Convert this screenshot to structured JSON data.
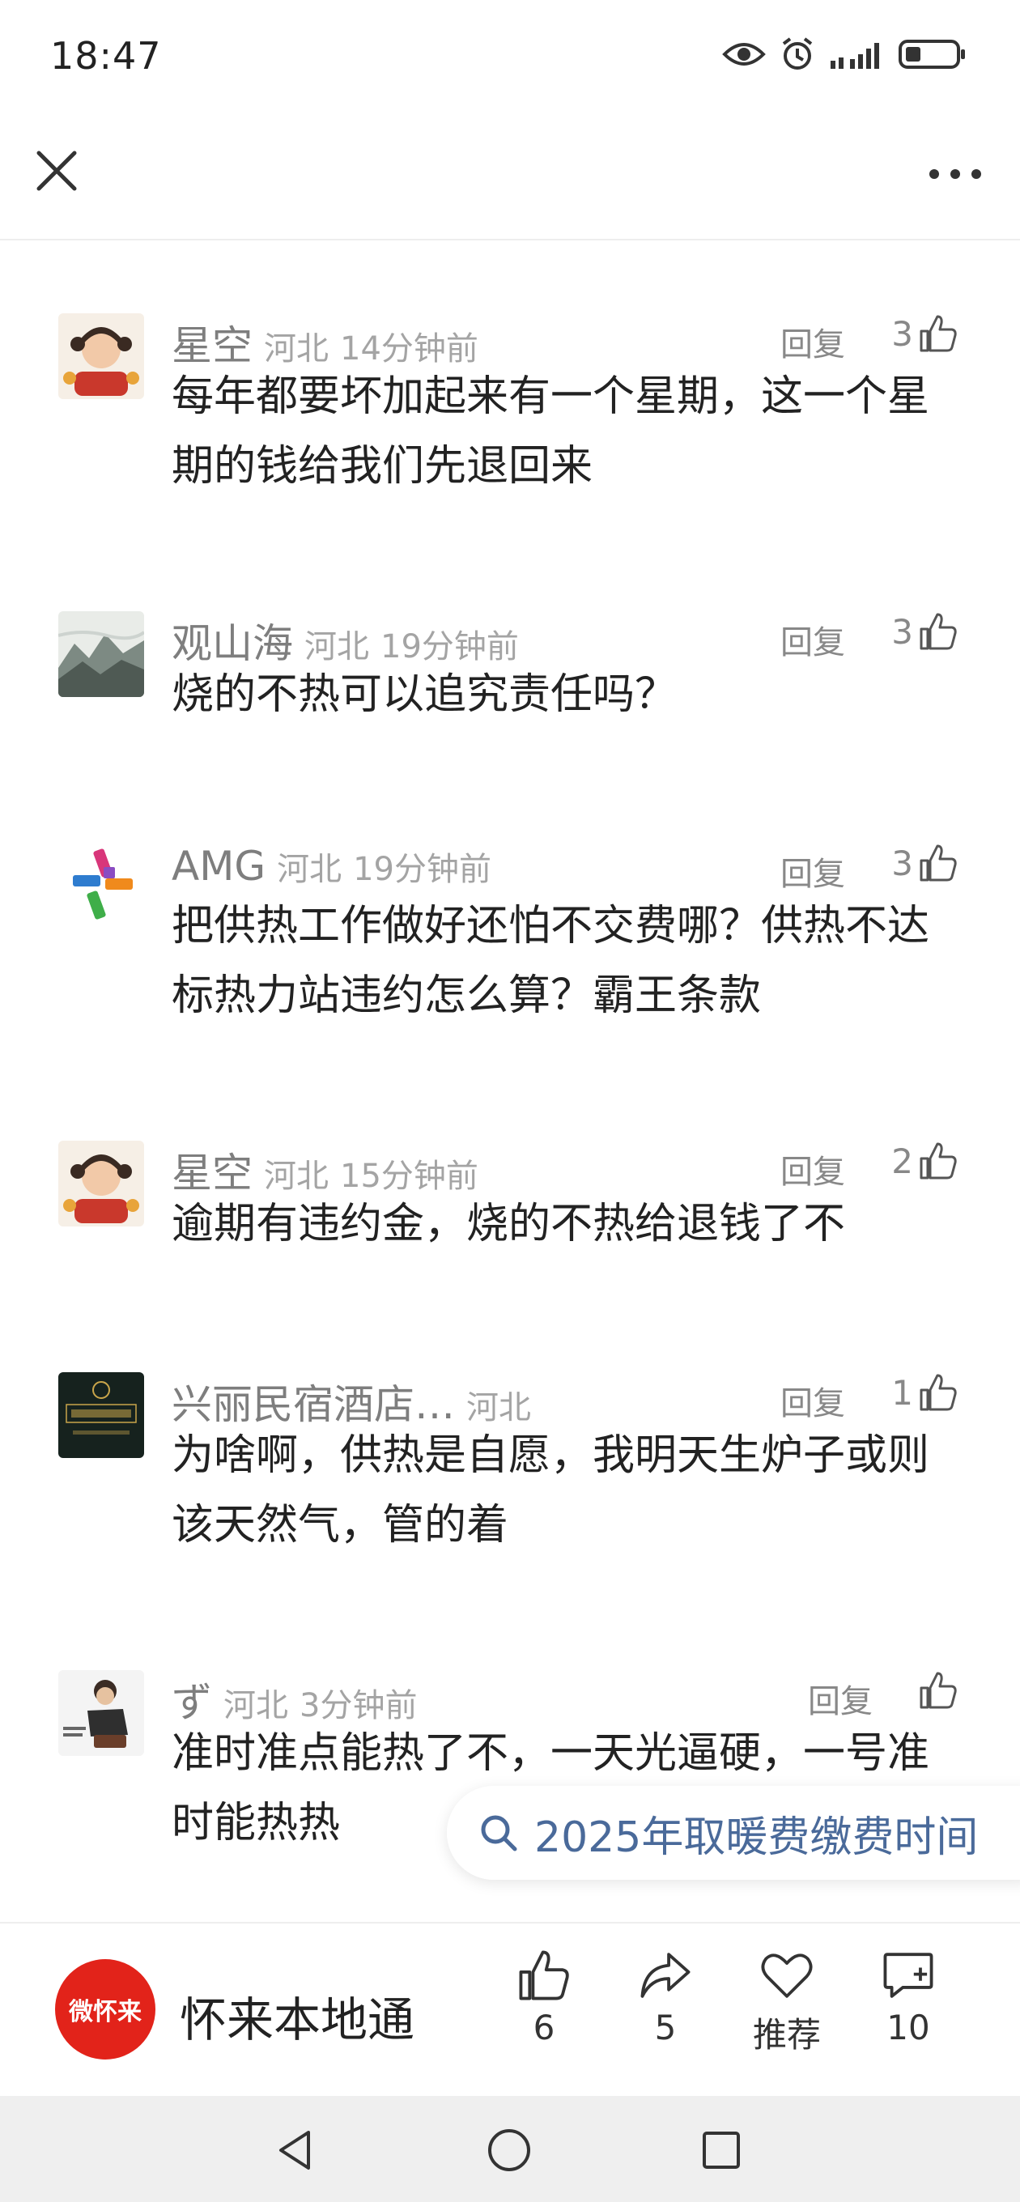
{
  "status_bar": {
    "time": "18:47"
  },
  "comments": [
    {
      "name": "星空",
      "location": "河北",
      "time": "14分钟前",
      "reply_label": "回复",
      "likes": "3",
      "text": "每年都要坏加起来有一个星期，这一个星期的钱给我们先退回来"
    },
    {
      "name": "观山海",
      "location": "河北",
      "time": "19分钟前",
      "reply_label": "回复",
      "likes": "3",
      "text": "烧的不热可以追究责任吗？"
    },
    {
      "name": "AMG",
      "location": "河北",
      "time": "19分钟前",
      "reply_label": "回复",
      "likes": "3",
      "text": "把供热工作做好还怕不交费哪？供热不达标热力站违约怎么算？霸王条款"
    },
    {
      "name": "星空",
      "location": "河北",
      "time": "15分钟前",
      "reply_label": "回复",
      "likes": "2",
      "text": "逾期有违约金，烧的不热给退钱了不"
    },
    {
      "name": "兴丽民宿酒店…",
      "location": "河北",
      "time": "",
      "reply_label": "回复",
      "likes": "1",
      "text": "为啥啊，供热是自愿，我明天生炉子或则该天然气，管的着"
    },
    {
      "name": "ず",
      "location": "河北",
      "time": "3分钟前",
      "reply_label": "回复",
      "likes": "",
      "text": "准时准点能热了不，一天光逼硬，一号准时能热热"
    }
  ],
  "search_suggestion": {
    "query": "2025年取暖费缴费时间"
  },
  "bottom_bar": {
    "account_name": "怀来本地通",
    "logo_text": "微怀来",
    "like_count": "6",
    "share_count": "5",
    "recommend_label": "推荐",
    "comment_count": "10"
  },
  "icons": {
    "close": "close-icon",
    "more": "more-icon",
    "like": "thumbs-up-icon",
    "share": "share-icon",
    "recommend": "heart-icon",
    "comment": "comment-icon"
  },
  "colors": {
    "brand": "#e2231a",
    "search_text": "#4a6a9a"
  }
}
